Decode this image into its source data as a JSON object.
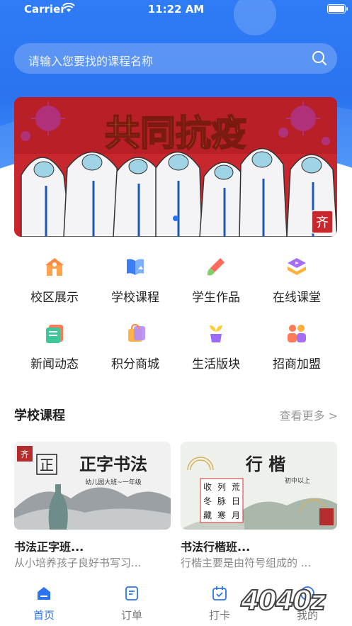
{
  "status_bar": {
    "carrier": "Carrier",
    "time": "11:22 AM"
  },
  "search": {
    "placeholder": "请输入您要找的课程名称"
  },
  "banner": {
    "headline": "共同抗疫",
    "stamp": "齐"
  },
  "menu": [
    {
      "label": "校区展示",
      "icon": "campus-icon"
    },
    {
      "label": "学校课程",
      "icon": "course-book-icon"
    },
    {
      "label": "学生作品",
      "icon": "brush-icon"
    },
    {
      "label": "在线课堂",
      "icon": "online-class-icon"
    },
    {
      "label": "新闻动态",
      "icon": "news-icon"
    },
    {
      "label": "积分商城",
      "icon": "shopping-bag-icon"
    },
    {
      "label": "生活版块",
      "icon": "plant-icon"
    },
    {
      "label": "招商加盟",
      "icon": "partners-icon"
    }
  ],
  "courses_section": {
    "title": "学校课程",
    "more": "查看更多 >"
  },
  "courses": [
    {
      "title": "书法正字班...",
      "desc": "从小培养孩子良好书写习...",
      "art_title": "正字书法",
      "art_char": "正",
      "art_sub": "幼儿园大班~一年级"
    },
    {
      "title": "书法行楷班...",
      "desc": "行楷主要是由符号组成的 ...",
      "art_title": "行 楷",
      "art_sub": "初中以上",
      "art_chars": [
        "收",
        "列",
        "荒",
        "冬",
        "脉",
        "日",
        "藏",
        "寒",
        "月"
      ]
    }
  ],
  "tabbar": [
    {
      "label": "首页",
      "icon": "home-icon",
      "active": true
    },
    {
      "label": "订单",
      "icon": "order-icon",
      "active": false
    },
    {
      "label": "打卡",
      "icon": "checkin-icon",
      "active": false
    },
    {
      "label": "我的",
      "icon": "profile-icon",
      "active": false
    }
  ],
  "watermark": "4040z",
  "colors": {
    "primary": "#2b73f0",
    "banner_red": "#c8282d",
    "banner_yellow": "#f5c82a"
  }
}
